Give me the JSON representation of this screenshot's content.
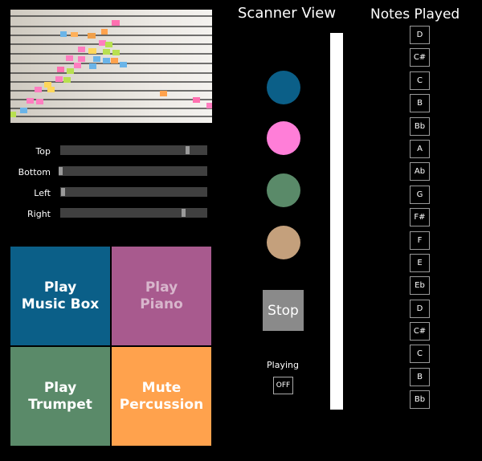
{
  "scanner": {
    "title": "Scanner View",
    "colors": [
      "#0b5f88",
      "#ff7ed8",
      "#5a8a69",
      "#c4a07c"
    ],
    "stop_label": "Stop",
    "playing_label": "Playing",
    "toggle_value": "OFF"
  },
  "sliders": [
    {
      "label": "Top",
      "value": 0.92
    },
    {
      "label": "Bottom",
      "value": 0.0
    },
    {
      "label": "Left",
      "value": 0.01
    },
    {
      "label": "Right",
      "value": 0.88
    }
  ],
  "instruments": [
    {
      "line1": "Play",
      "line2": "Music Box",
      "bg": "#0b5f88",
      "fg": "#ffffff"
    },
    {
      "line1": "Play",
      "line2": "Piano",
      "bg": "#a85a8e",
      "fg": "#d8b6cc"
    },
    {
      "line1": "Play",
      "line2": "Trumpet",
      "bg": "#5a8a69",
      "fg": "#ffffff"
    },
    {
      "line1": "Mute",
      "line2": "Percussion",
      "bg": "#ffa24d",
      "fg": "#ffffff"
    }
  ],
  "notes": {
    "title": "Notes Played",
    "items": [
      "D",
      "C#",
      "C",
      "B",
      "Bb",
      "A",
      "Ab",
      "G",
      "F#",
      "F",
      "E",
      "Eb",
      "D",
      "C#",
      "C",
      "B",
      "Bb"
    ]
  }
}
